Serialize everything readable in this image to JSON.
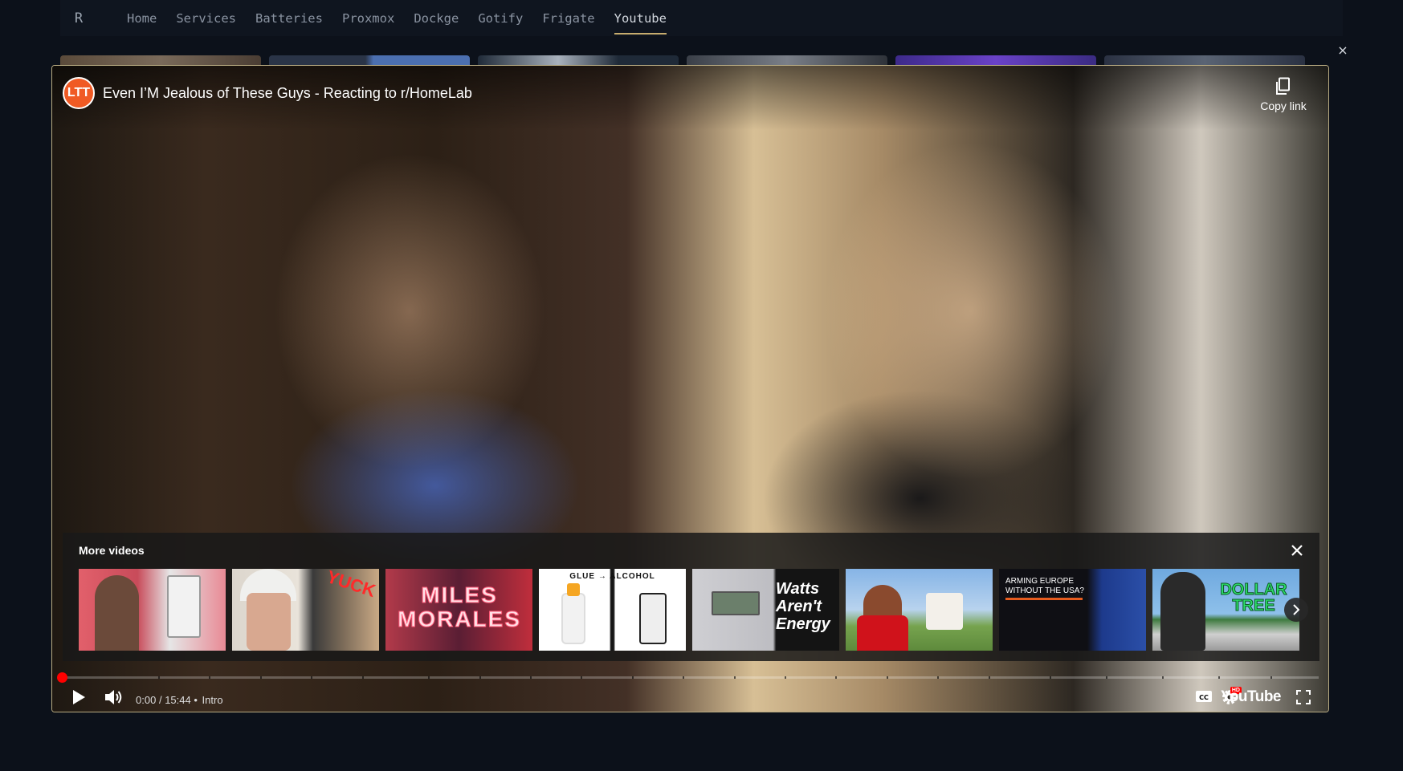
{
  "app": {
    "logo_letter": "R"
  },
  "nav": {
    "items": [
      {
        "label": "Home"
      },
      {
        "label": "Services"
      },
      {
        "label": "Batteries"
      },
      {
        "label": "Proxmox"
      },
      {
        "label": "Dockge"
      },
      {
        "label": "Gotify"
      },
      {
        "label": "Frigate"
      },
      {
        "label": "Youtube",
        "active": true
      }
    ]
  },
  "overlay": {
    "close_glyph": "×"
  },
  "player": {
    "channel_logo_text": "LTT",
    "title": "Even I’M Jealous of These Guys - Reacting to r/HomeLab",
    "copy_link_label": "Copy link",
    "more_videos": {
      "title": "More videos",
      "thumbnails": [
        {
          "text": ""
        },
        {
          "text": "YUCK"
        },
        {
          "text": "MILES MORALES"
        },
        {
          "text": "GLUE → ALCOHOL"
        },
        {
          "text": "Watts Aren't Energy"
        },
        {
          "text": ""
        },
        {
          "text": "ARMING EUROPE WITHOUT THE USA?"
        },
        {
          "text": "DOLLAR TREE"
        }
      ]
    },
    "progress": {
      "played_fraction": 0.0
    },
    "time_current": "0:00",
    "time_separator": "/",
    "time_total": "15:44",
    "chapter_dot": "•",
    "chapter": "Intro",
    "wordmark": "YouTube",
    "hd_badge": "HD"
  },
  "colors": {
    "accent": "#c7ad6e",
    "progress": "#ff0000",
    "channel": "#f05a24"
  }
}
